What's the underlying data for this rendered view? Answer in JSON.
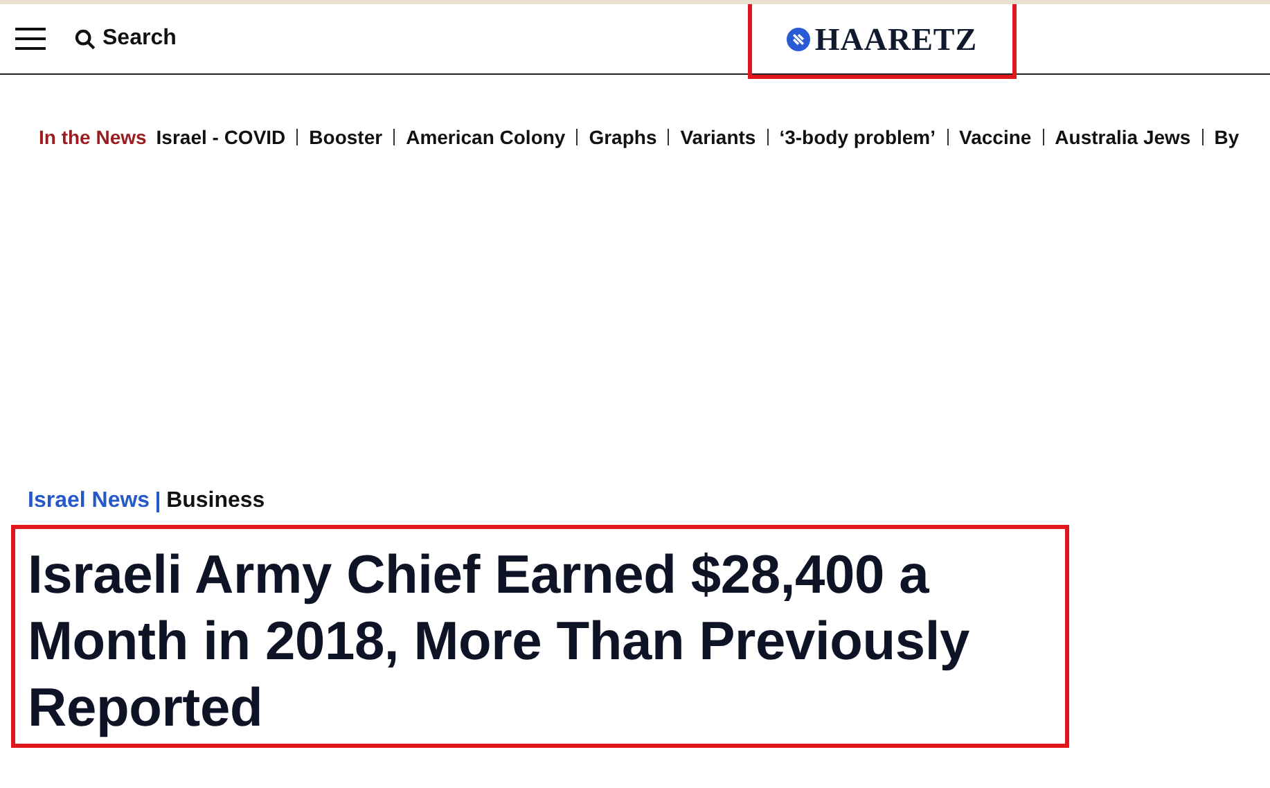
{
  "header": {
    "search_label": "Search",
    "logo": "HAARETZ",
    "logo_highlighted": true
  },
  "trending": {
    "label": "In the News",
    "items": [
      "Israel - COVID",
      "Booster",
      "American Colony",
      "Graphs",
      "Variants",
      "‘3-body problem’",
      "Vaccine",
      "Australia Jews",
      "By"
    ]
  },
  "article": {
    "breadcrumb": [
      {
        "label": "Israel News",
        "kind": "section"
      },
      {
        "label": "Business",
        "kind": "subsection"
      }
    ],
    "headline": "Israeli Army Chief Earned $28,400 a Month in 2018, More Than Previously Reported",
    "headline_highlighted": true
  }
}
